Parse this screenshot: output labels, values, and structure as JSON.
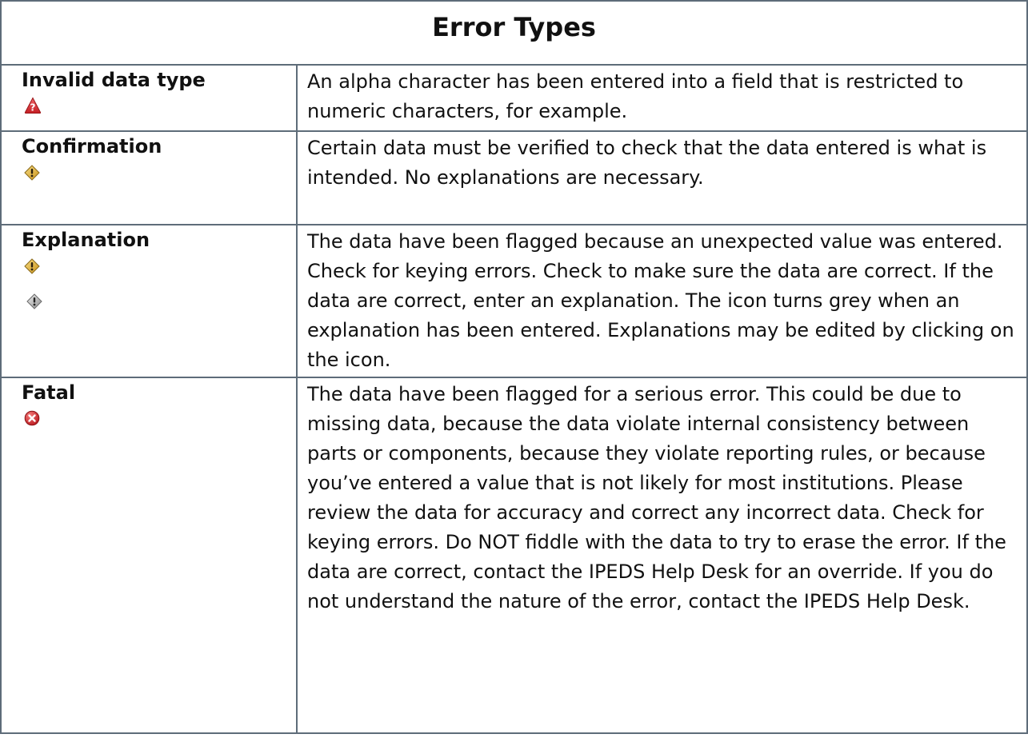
{
  "title": "Error Types",
  "rows": [
    {
      "type": "Invalid data type",
      "icons": [
        "red-warning-triangle-icon"
      ],
      "description": "An alpha character has been entered into a field that is restricted to numeric characters, for example."
    },
    {
      "type": "Confirmation",
      "icons": [
        "yellow-exclamation-diamond-icon"
      ],
      "description": "Certain data must be verified to check that the data entered is what is intended.  No explanations are necessary."
    },
    {
      "type": "Explanation",
      "icons": [
        "yellow-exclamation-diamond-icon",
        "grey-exclamation-diamond-icon"
      ],
      "description": "The data have been flagged because an unexpected value was entered.  Check for keying errors.  Check to make sure the data are correct.  If the data are correct, enter an explanation.  The icon turns grey when an explanation has been entered.  Explanations may be edited by clicking on the icon."
    },
    {
      "type": "Fatal",
      "icons": [
        "red-x-circle-icon"
      ],
      "description": "The data have been flagged for a serious error.  This could be due to missing data, because the data violate internal consistency between parts or components, because they violate reporting rules, or because you’ve entered a value that is not likely for most institutions.  Please review the data for accuracy and correct any incorrect data.  Check for keying errors.  Do NOT fiddle with the data to try to erase the error.  If the data are correct, contact the IPEDS Help Desk for an override.  If you do not understand the nature of the error, contact the IPEDS Help Desk."
    }
  ],
  "colors": {
    "border": "#5e6c79",
    "text": "#111111",
    "icon_red": "#d2262a",
    "icon_yellow": "#e4b93a",
    "icon_grey": "#a9a9a9"
  }
}
